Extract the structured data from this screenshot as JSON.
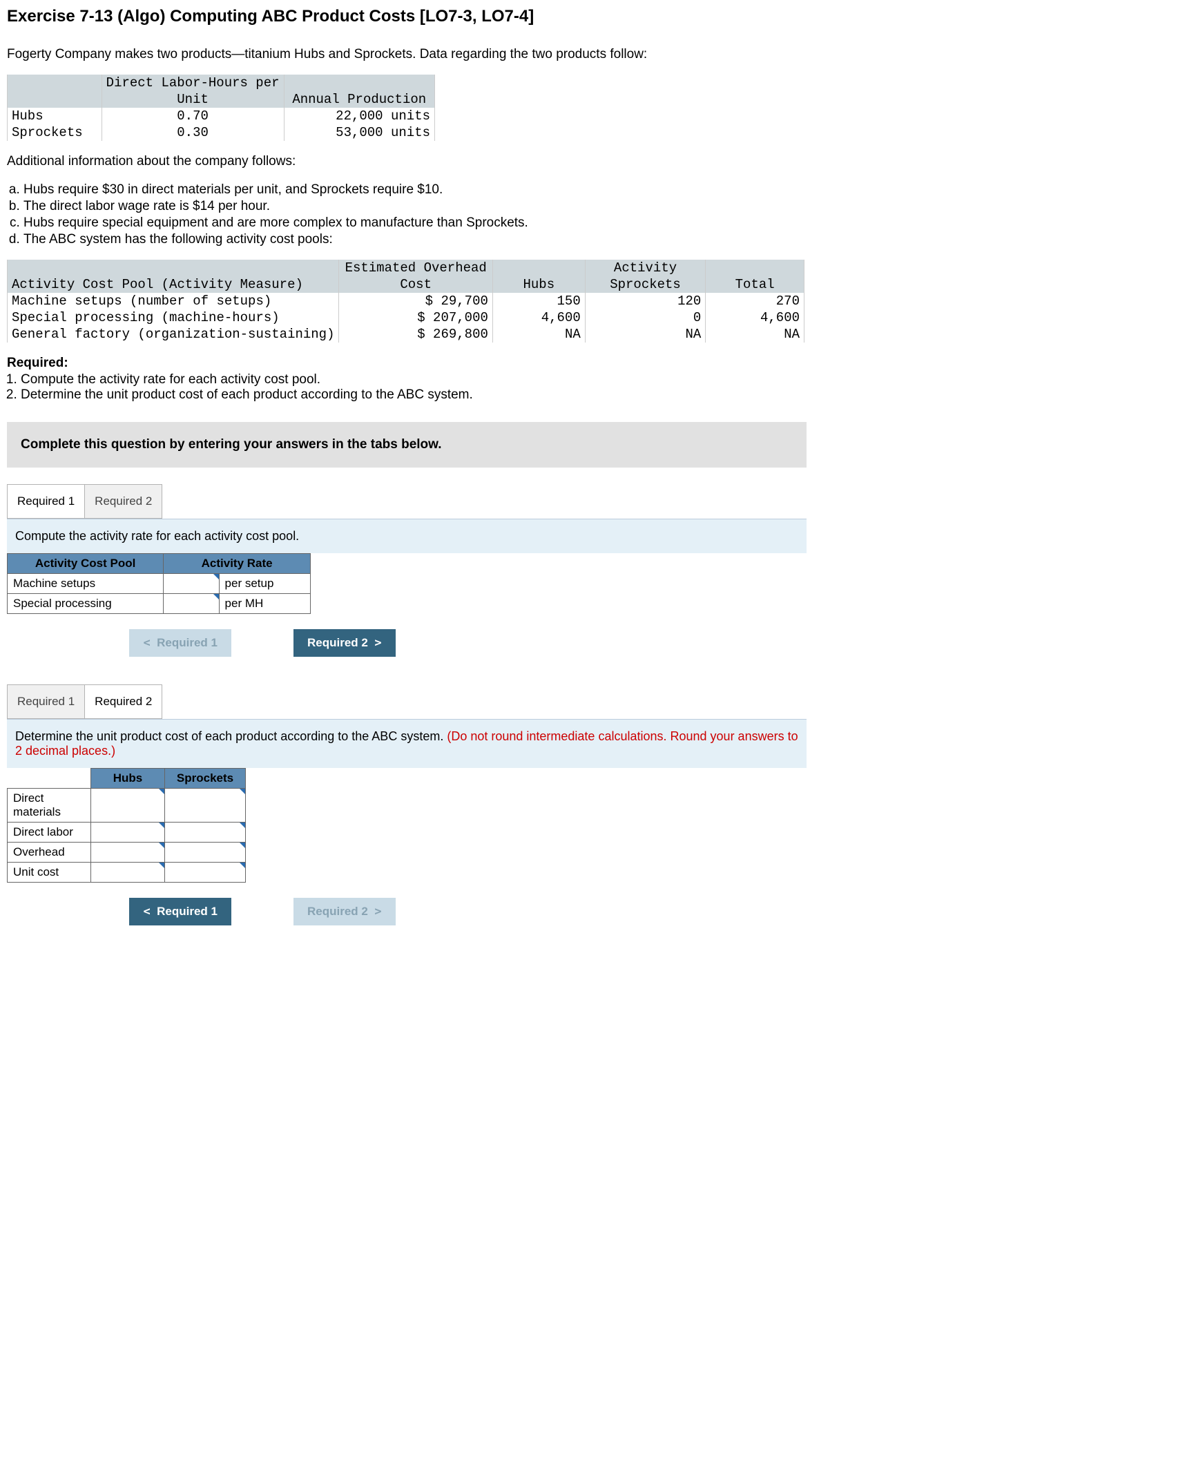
{
  "title": "Exercise 7-13 (Algo) Computing ABC Product Costs [LO7-3, LO7-4]",
  "intro": "Fogerty Company makes two products—titanium Hubs and Sprockets. Data regarding the two products follow:",
  "prod_table": {
    "h1": "Direct Labor-Hours per",
    "h1b": "Unit",
    "h2": "Annual Production",
    "rows": [
      {
        "name": "Hubs",
        "dlh": "0.70",
        "prod": "22,000 units"
      },
      {
        "name": "Sprockets",
        "dlh": "0.30",
        "prod": "53,000 units"
      }
    ]
  },
  "add_info_lead": "Additional information about the company follows:",
  "info": [
    "Hubs require $30 in direct materials per unit, and Sprockets require $10.",
    "The direct labor wage rate is $14 per hour.",
    "Hubs require special equipment and are more complex to manufacture than Sprockets.",
    "The ABC system has the following activity cost pools:"
  ],
  "pool_table": {
    "h_pool": "Activity Cost Pool (Activity Measure)",
    "h_cost1": "Estimated Overhead",
    "h_cost2": "Cost",
    "h_act": "Activity",
    "h_hubs": "Hubs",
    "h_spr": "Sprockets",
    "h_tot": "Total",
    "rows": [
      {
        "pool": "Machine setups (number of setups)",
        "cost": "$ 29,700",
        "hubs": "150",
        "spr": "120",
        "tot": "270"
      },
      {
        "pool": "Special processing (machine-hours)",
        "cost": "$ 207,000",
        "hubs": "4,600",
        "spr": "0",
        "tot": "4,600"
      },
      {
        "pool": "General factory (organization-sustaining)",
        "cost": "$ 269,800",
        "hubs": "NA",
        "spr": "NA",
        "tot": "NA"
      }
    ]
  },
  "required_head": "Required:",
  "required": [
    "Compute the activity rate for each activity cost pool.",
    "Determine the unit product cost of each product according to the ABC system."
  ],
  "instr_box": "Complete this question by entering your answers in the tabs below.",
  "tabs": {
    "r1": "Required 1",
    "r2": "Required 2"
  },
  "panel1": {
    "prompt": "Compute the activity rate for each activity cost pool.",
    "th_pool": "Activity Cost Pool",
    "th_rate": "Activity Rate",
    "rows": [
      {
        "name": "Machine setups",
        "unit": "per setup"
      },
      {
        "name": "Special processing",
        "unit": "per MH"
      }
    ]
  },
  "panel2": {
    "prompt_a": "Determine the unit product cost of each product according to the ABC system. ",
    "prompt_b": "(Do not round intermediate calculations. Round your answers to 2 decimal places.)",
    "th_hubs": "Hubs",
    "th_spr": "Sprockets",
    "rows": [
      "Direct materials",
      "Direct labor",
      "Overhead",
      "Unit cost"
    ]
  },
  "nav": {
    "prev": "Required 1",
    "next": "Required 2"
  }
}
